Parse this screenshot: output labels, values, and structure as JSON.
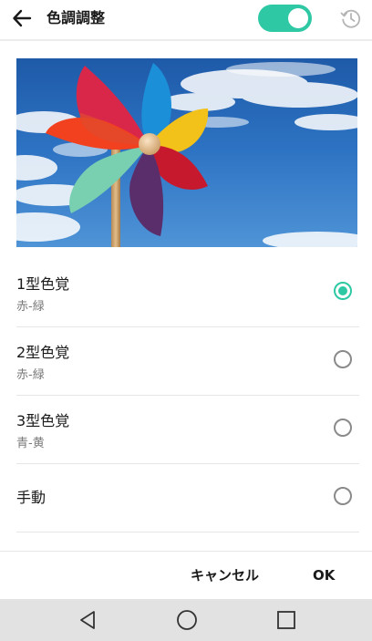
{
  "header": {
    "title": "色調調整",
    "toggle_on": true,
    "accent_color": "#2ec9a4"
  },
  "icons": {
    "back": "arrow-left-icon",
    "history": "history-icon",
    "nav_back": "triangle-back-icon",
    "nav_home": "circle-home-icon",
    "nav_recent": "square-recents-icon"
  },
  "options": [
    {
      "label": "1型色覚",
      "sub": "赤-緑",
      "selected": true
    },
    {
      "label": "2型色覚",
      "sub": "赤-緑",
      "selected": false
    },
    {
      "label": "3型色覚",
      "sub": "青-黄",
      "selected": false
    },
    {
      "label": "手動",
      "sub": "",
      "selected": false
    }
  ],
  "actions": {
    "cancel_label": "キャンセル",
    "ok_label": "OK"
  }
}
